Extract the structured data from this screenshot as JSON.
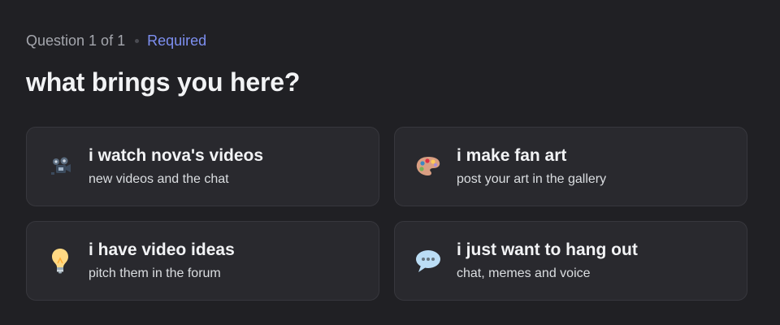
{
  "header": {
    "question_count": "Question 1 of 1",
    "required_label": "Required",
    "title": "what brings you here?"
  },
  "options": [
    {
      "icon": "film-camera-icon",
      "label": "i watch nova's videos",
      "description": "new videos and the chat"
    },
    {
      "icon": "artist-palette-icon",
      "label": "i make fan art",
      "description": "post your art in the gallery"
    },
    {
      "icon": "light-bulb-icon",
      "label": "i have video ideas",
      "description": "pitch them in the forum"
    },
    {
      "icon": "speech-bubble-icon",
      "label": "i just want to hang out",
      "description": "chat, memes and voice"
    }
  ],
  "colors": {
    "background": "#202024",
    "card": "#29292e",
    "card_border": "#37373d",
    "accent": "#7d8ff0",
    "muted": "#a4a6ad"
  }
}
